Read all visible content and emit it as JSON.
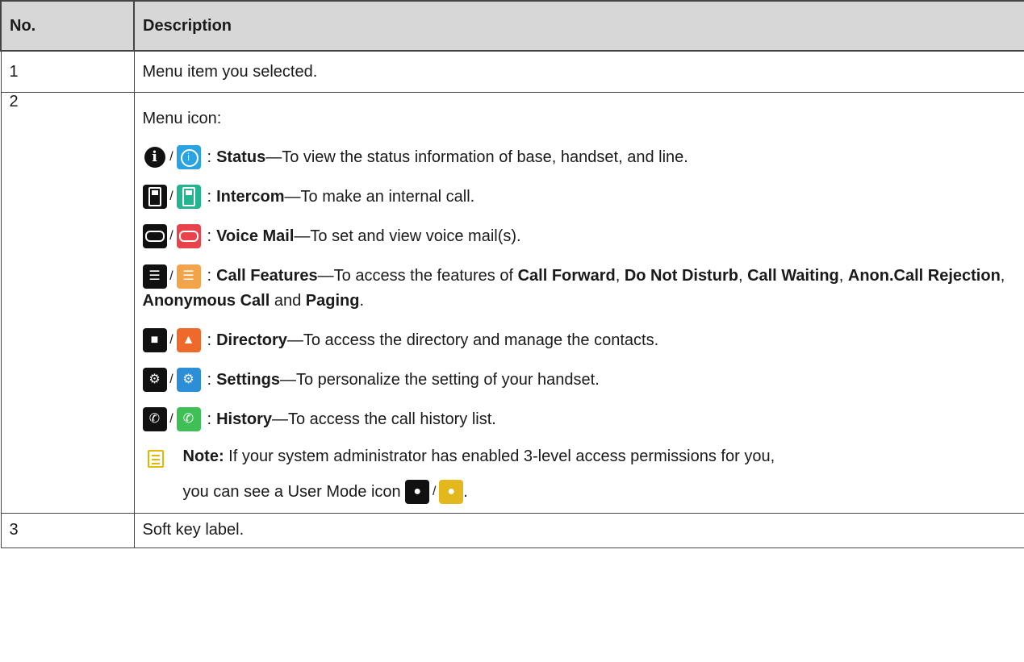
{
  "headers": {
    "no": "No.",
    "description": "Description"
  },
  "rows": [
    {
      "no": "1",
      "text": "Menu item you selected."
    },
    {
      "no": "2"
    },
    {
      "no": "3",
      "text": "Soft key label."
    }
  ],
  "menu_intro": "Menu icon:",
  "slash": "/",
  "colon": ":",
  "items": {
    "status": {
      "name": "Status",
      "desc": "—To view the status information of base, handset, and line."
    },
    "intercom": {
      "name": "Intercom",
      "desc": "—To make an internal call."
    },
    "voicemail": {
      "name": "Voice Mail",
      "desc": "—To set and view voice mail(s)."
    },
    "callfeatures": {
      "name": "Call Features",
      "desc": "—To access the features of ",
      "f1": "Call Forward",
      "sep1": ", ",
      "f2": "Do Not Disturb",
      "sep2": ", ",
      "f3": "Call Waiting",
      "sep3": ", ",
      "f4": "Anon.Call Rejection",
      "sep4": ", ",
      "f5": "Anonymous Call",
      "and": " and ",
      "f6": "Paging",
      "end": "."
    },
    "directory": {
      "name": "Directory",
      "desc": "—To access the directory and manage the contacts."
    },
    "settings": {
      "name": "Settings",
      "desc": "—To personalize the setting of your handset."
    },
    "history": {
      "name": "History",
      "desc": "—To access the call history list."
    }
  },
  "note": {
    "label": "Note:",
    "text1": "If your system administrator has enabled 3-level access permissions for you,",
    "text2": "you can see a User Mode icon",
    "end": "."
  },
  "icons": {
    "status": "info-icon",
    "intercom": "handset-icon",
    "voicemail": "voicemail-icon",
    "callfeatures": "call-features-icon",
    "directory": "directory-icon",
    "settings": "gear-icon",
    "history": "history-icon",
    "usermode": "user-mode-icon",
    "note": "note-icon"
  },
  "colors": {
    "header_bg": "#d7d7d7",
    "status": "#2aa3e0",
    "intercom": "#22b58f",
    "voicemail": "#e8424b",
    "callfeatures": "#f3a44a",
    "directory": "#ef6a2a",
    "settings": "#2b8ed6",
    "history": "#3fbf56",
    "usermode": "#e3b81c"
  }
}
